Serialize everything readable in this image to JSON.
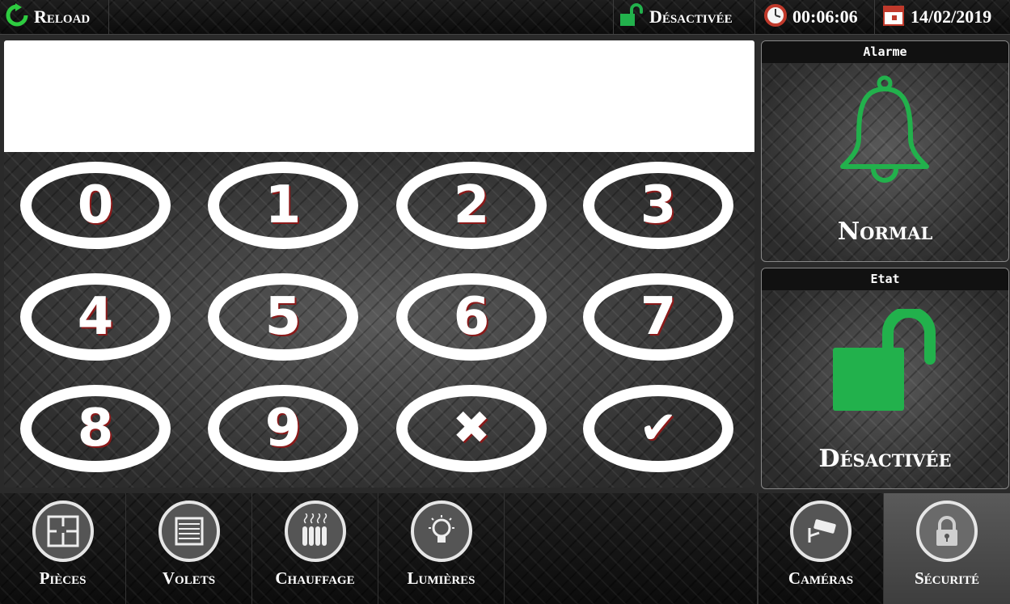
{
  "topbar": {
    "reload_label": "Reload",
    "lock_status": "Désactivée",
    "time": "00:06:06",
    "date": "14/02/2019",
    "icons": [
      "reload-icon",
      "unlock-icon",
      "clock-icon",
      "calendar-icon"
    ]
  },
  "display": {
    "value": ""
  },
  "keypad": {
    "keys": [
      "0",
      "1",
      "2",
      "3",
      "4",
      "5",
      "6",
      "7",
      "8",
      "9"
    ],
    "clear_symbol": "✖",
    "confirm_symbol": "✔"
  },
  "alarm_panel": {
    "title": "Alarme",
    "status": "Normal",
    "icon": "bell-icon",
    "icon_color": "#22b14c"
  },
  "state_panel": {
    "title": "Etat",
    "status": "Désactivée",
    "icon": "unlock-icon",
    "icon_color": "#22b14c"
  },
  "nav": {
    "items": [
      {
        "label": "Pièces",
        "icon": "floorplan-icon"
      },
      {
        "label": "Volets",
        "icon": "shutter-icon"
      },
      {
        "label": "Chauffage",
        "icon": "radiator-icon"
      },
      {
        "label": "Lumières",
        "icon": "lightbulb-icon"
      },
      {
        "label": "Caméras",
        "icon": "camera-icon"
      },
      {
        "label": "Sécurité",
        "icon": "lock-icon",
        "active": true
      }
    ]
  },
  "colors": {
    "accent_green": "#22b14c",
    "background": "#2a2a2a"
  }
}
